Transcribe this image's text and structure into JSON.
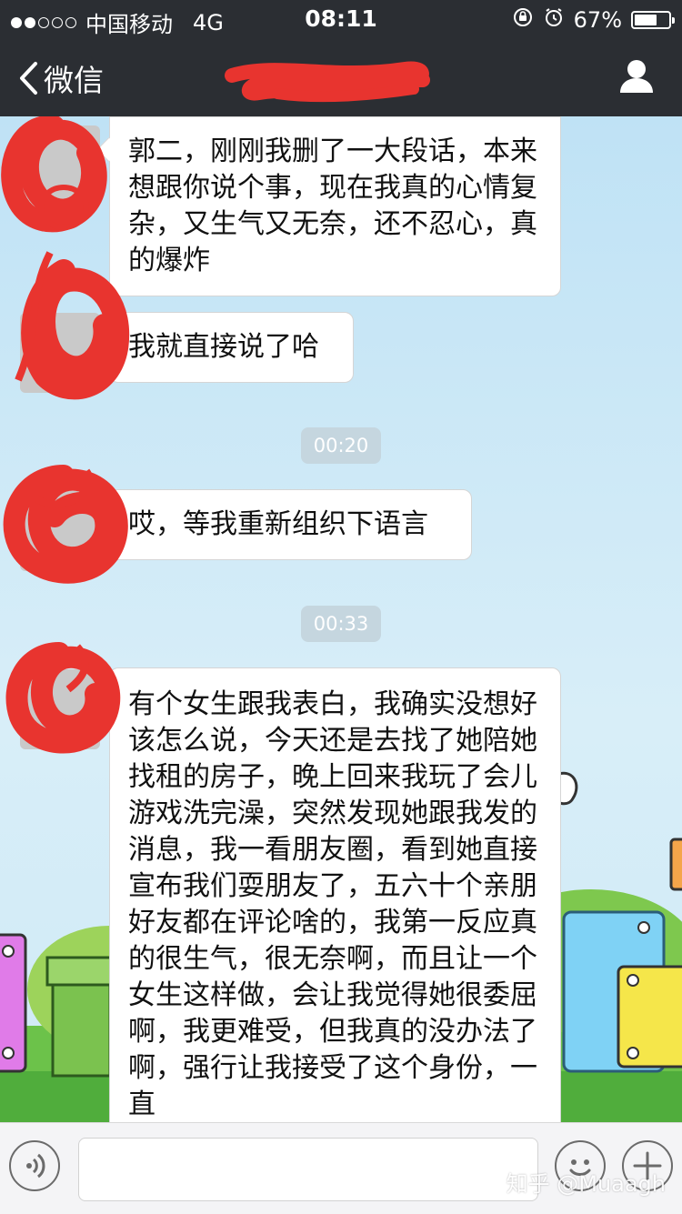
{
  "status_bar": {
    "carrier": "中国移动",
    "network": "4G",
    "time": "08:11",
    "battery": "67%",
    "battery_level": 0.67,
    "signal_bars_full": 2,
    "signal_bars_total": 5
  },
  "nav": {
    "back_label": "微信",
    "title": "",
    "profile_icon": "person-icon"
  },
  "messages": [
    {
      "type": "text",
      "text": "郭二，刚刚我删了一大段话，本来想跟你说个事，现在我真的心情复杂，又生气又无奈，还不忍心，真的爆炸"
    },
    {
      "type": "text",
      "text": "我就直接说了哈"
    },
    {
      "type": "timestamp",
      "text": "00:20"
    },
    {
      "type": "text",
      "text": "哎，等我重新组织下语言"
    },
    {
      "type": "timestamp",
      "text": "00:33"
    },
    {
      "type": "text",
      "text": "有个女生跟我表白，我确实没想好该怎么说，今天还是去找了她陪她找租的房子，晚上回来我玩了会儿游戏洗完澡，突然发现她跟我发的消息，我一看朋友圈，看到她直接宣布我们耍朋友了，五六十个亲朋好友都在评论啥的，我第一反应真的很生气，很无奈啊，而且让一个女生这样做，会让我觉得她很委屈啊，我更难受，但我真的没办法了啊，强行让我接受了这个身份，一直"
    }
  ],
  "input_bar": {
    "voice_icon": "voice-icon",
    "emoji_icon": "emoji-icon",
    "plus_icon": "plus-icon"
  },
  "watermark": "知乎 @Muaagh",
  "colors": {
    "nav_bg": "#2b2e33",
    "redaction": "#e8342f",
    "timestamp_bg": "#c5d6df"
  }
}
